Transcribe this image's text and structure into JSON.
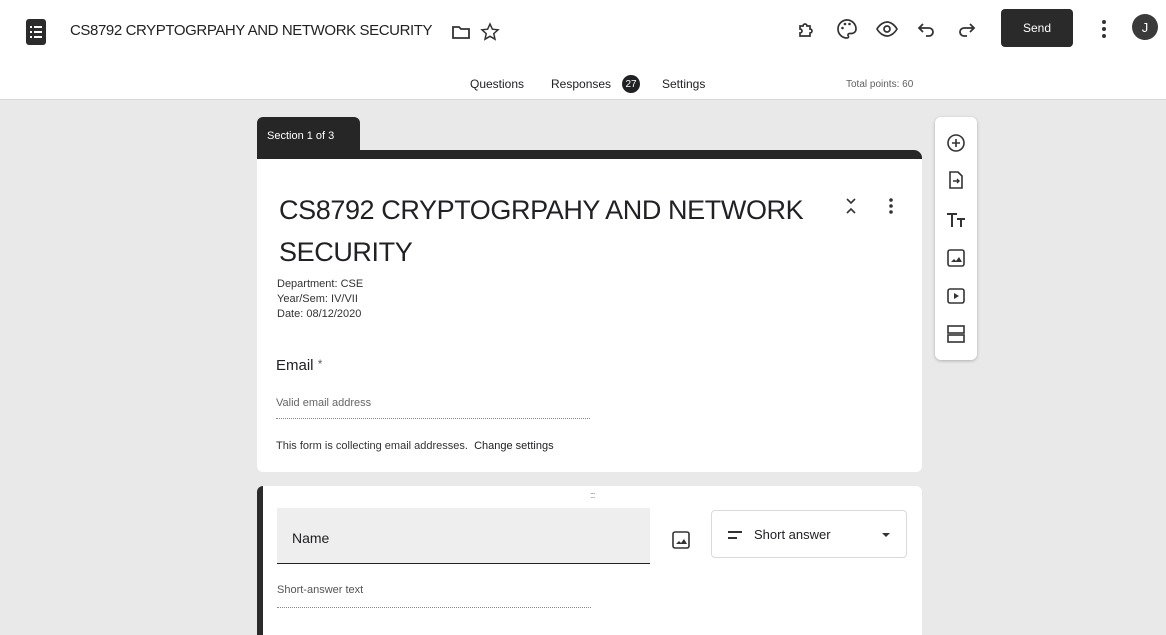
{
  "header": {
    "title": "CS8792 CRYPTOGRPAHY AND NETWORK SECURITY",
    "send_label": "Send",
    "avatar_initial": "J",
    "icons": [
      "form-logo-icon",
      "folder-icon",
      "star-icon",
      "addon-icon",
      "palette-icon",
      "preview-icon",
      "undo-icon",
      "redo-icon",
      "more-vert-icon"
    ]
  },
  "tabs": {
    "questions": "Questions",
    "responses": "Responses",
    "responses_count": "27",
    "settings": "Settings"
  },
  "total_points": "Total points: 60",
  "section": {
    "label": "Section 1 of 3"
  },
  "form": {
    "title": "CS8792 CRYPTOGRPAHY AND NETWORK SECURITY",
    "description": {
      "department": "Department: CSE",
      "year_sem": "Year/Sem: IV/VII",
      "date": "Date: 08/12/2020"
    },
    "email_label": "Email",
    "required_mark": "*",
    "email_placeholder": "Valid email address",
    "collect_note": "This form is collecting email addresses.",
    "change_settings": "Change settings"
  },
  "question": {
    "drag_handle": ":::",
    "title": "Name",
    "type_label": "Short answer",
    "answer_placeholder": "Short-answer text"
  },
  "toolbar": {
    "items": [
      "add-question-icon",
      "import-questions-icon",
      "add-title-icon",
      "add-image-icon",
      "add-video-icon",
      "add-section-icon"
    ]
  },
  "colors": {
    "accent": "#262626",
    "page_bg": "#e9e9e9",
    "card_bg": "#ffffff"
  }
}
